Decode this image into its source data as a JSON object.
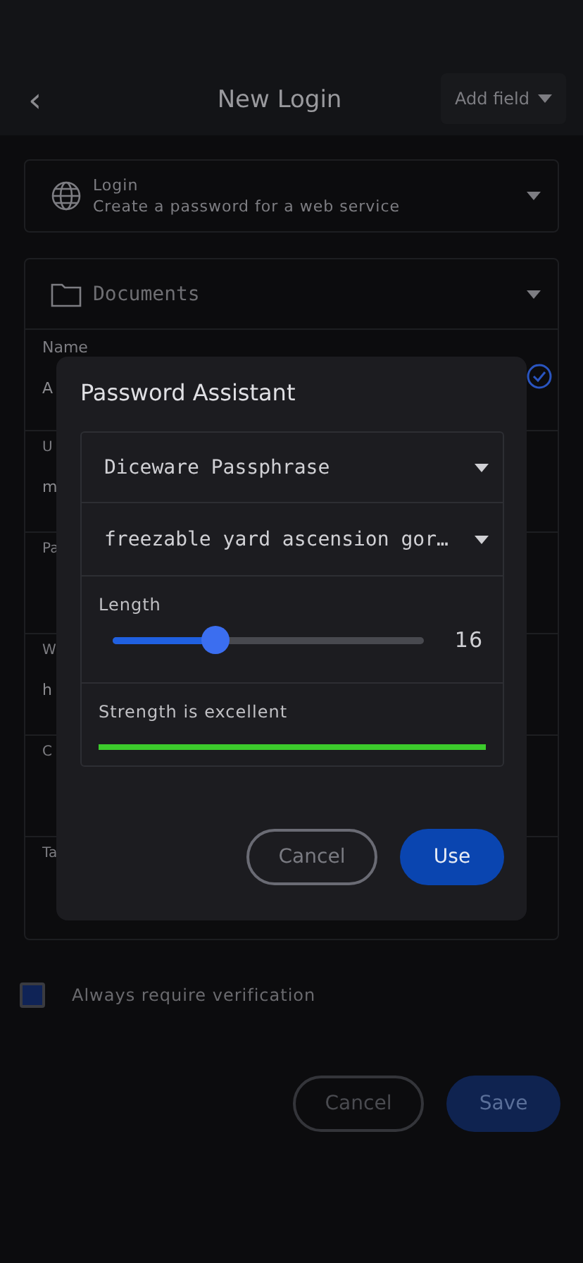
{
  "header": {
    "back_icon": "‹",
    "title": "New Login",
    "add_field": "Add field"
  },
  "type_select": {
    "title": "Login",
    "subtitle": "Create a password for a web service"
  },
  "folder": {
    "name": "Documents"
  },
  "fields": [
    {
      "label": "Name",
      "value": "A",
      "verified": true
    },
    {
      "label": "U",
      "value": "m"
    },
    {
      "label": "Pa"
    },
    {
      "label": "W",
      "value": "h"
    },
    {
      "label": "C"
    },
    {
      "label": "Ta"
    }
  ],
  "verification": {
    "label": "Always require verification",
    "checked": true
  },
  "actions": {
    "cancel": "Cancel",
    "save": "Save"
  },
  "dialog": {
    "title": "Password Assistant",
    "generator": "Diceware Passphrase",
    "passphrase": "freezable yard ascension gor…",
    "length_label": "Length",
    "length": {
      "level": 0.33
    },
    "length_value": "16",
    "strength_label": "Strength is excellent",
    "strength": {
      "level": 1
    },
    "cancel": "Cancel",
    "use": "Use"
  }
}
